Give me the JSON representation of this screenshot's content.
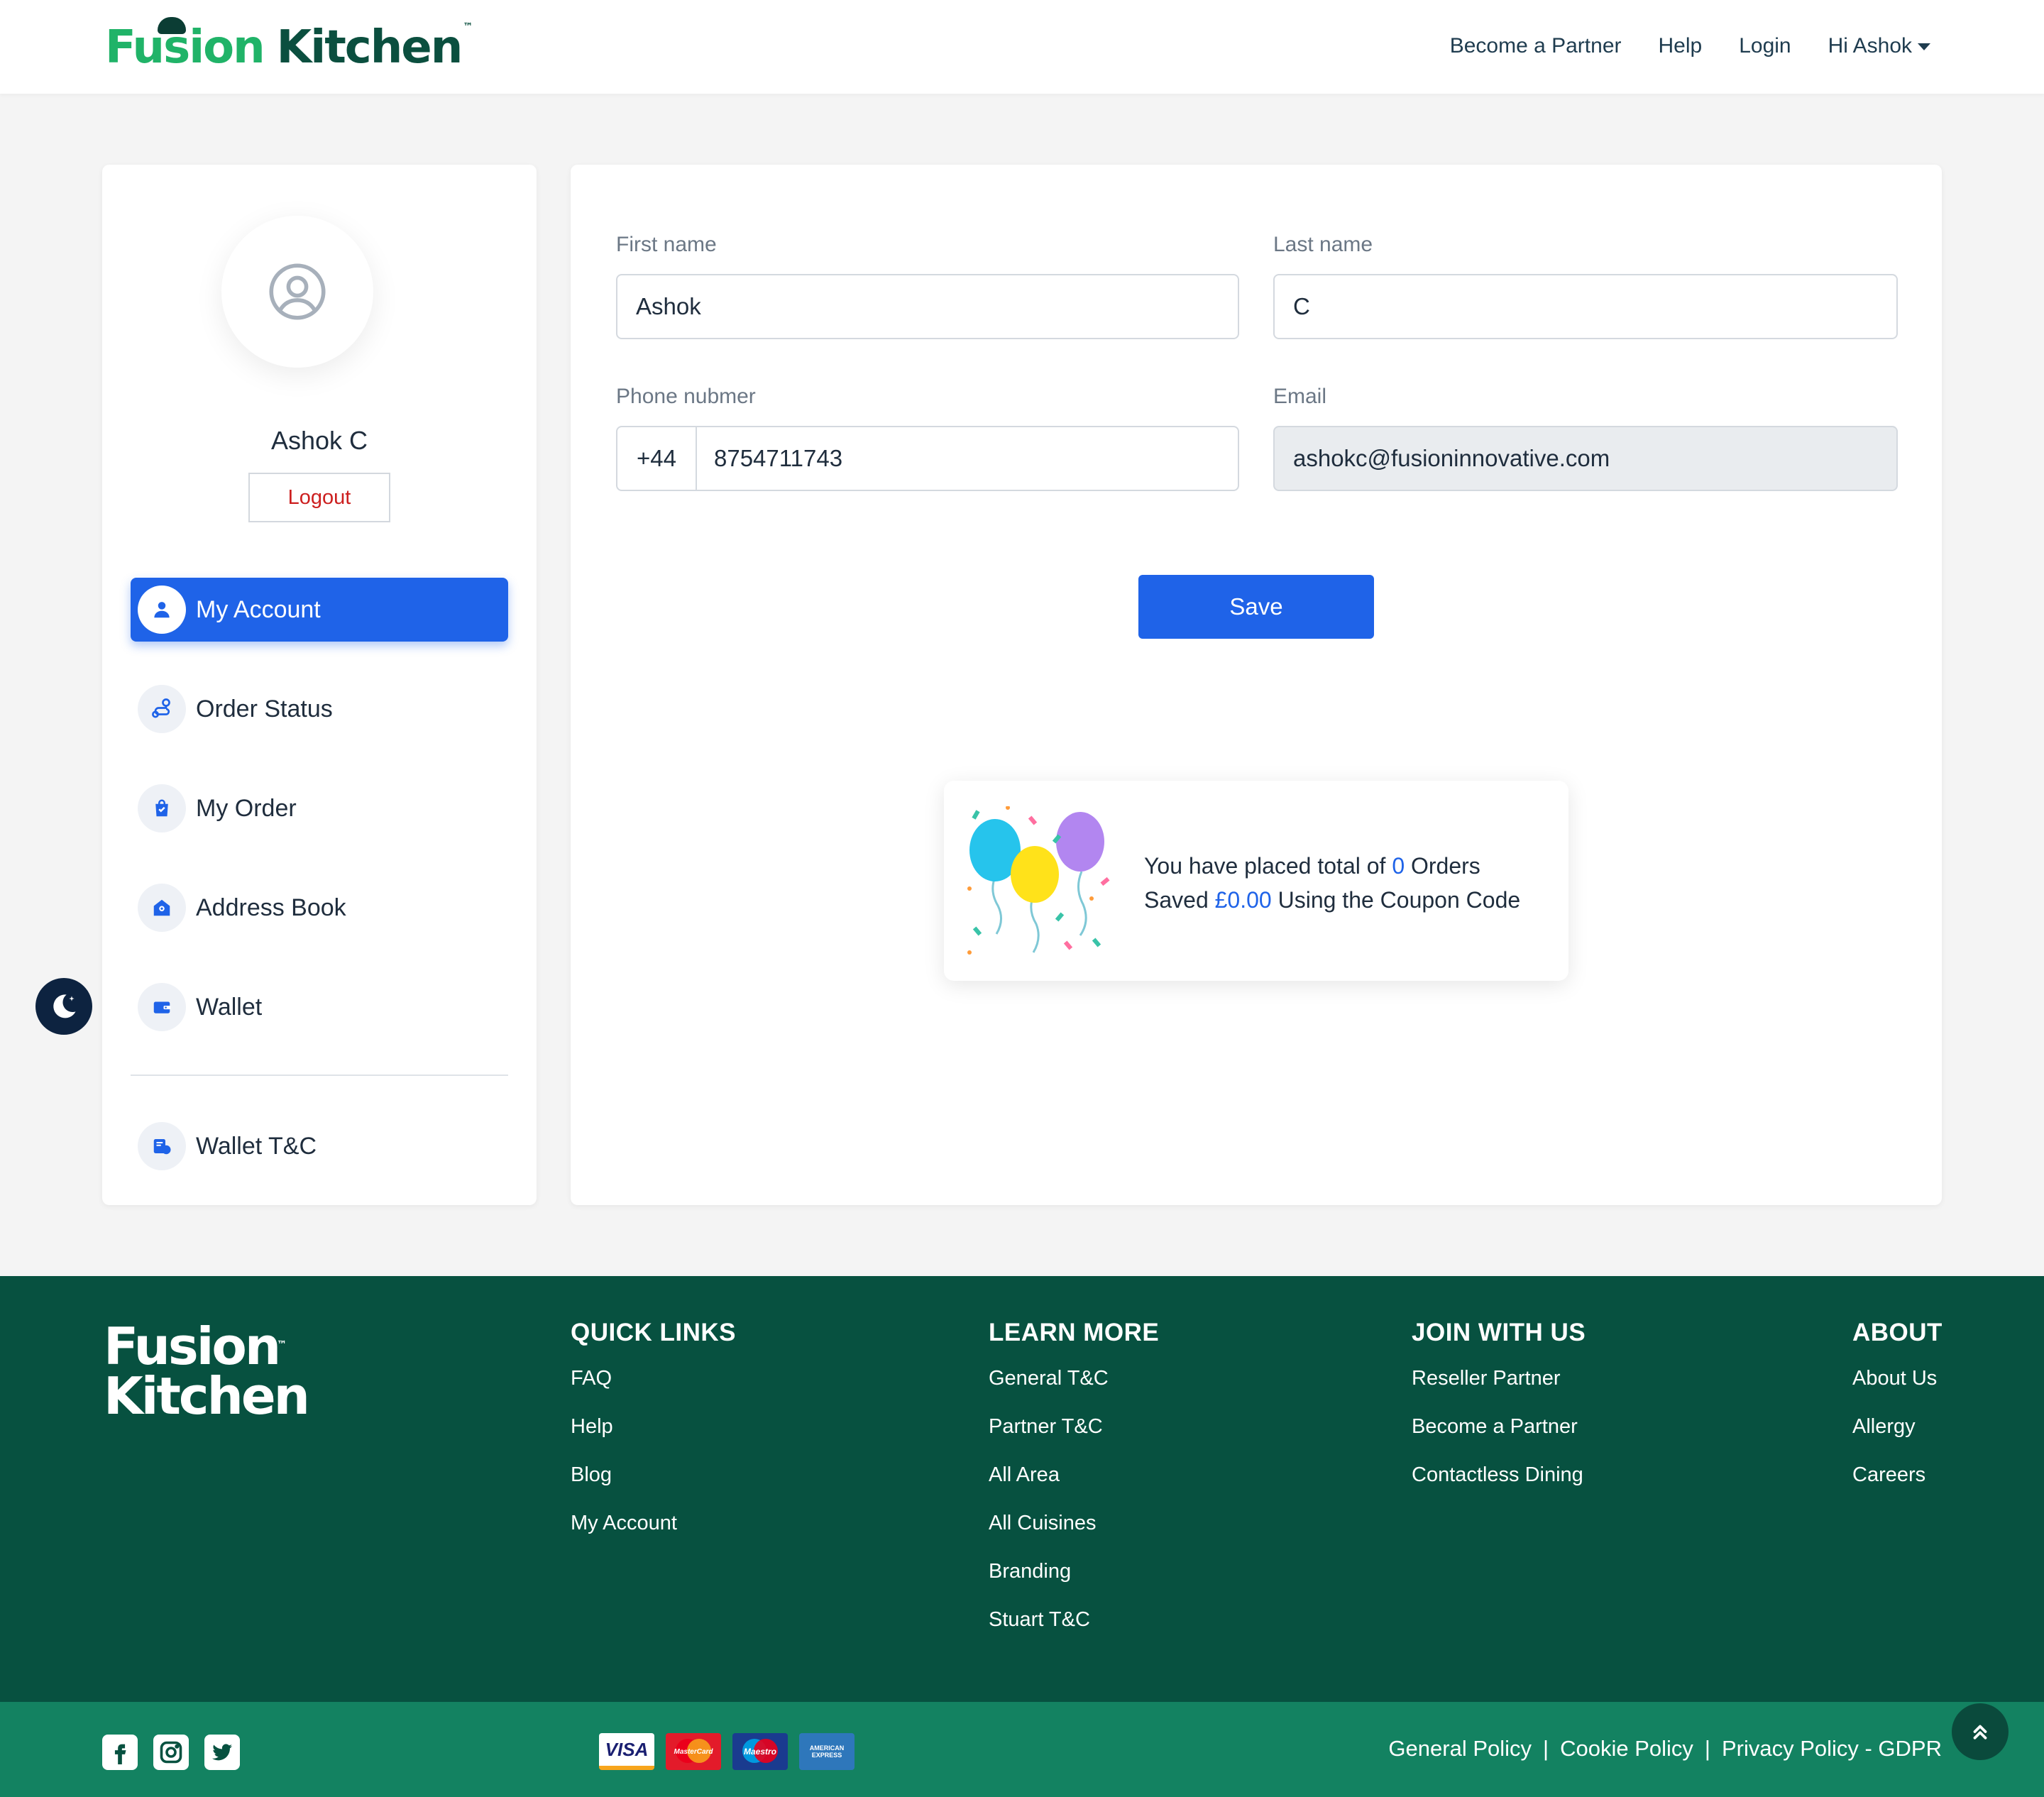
{
  "header": {
    "logo_part1": "Fusion",
    "logo_part2": "Kitchen",
    "logo_tm": "™",
    "nav": {
      "become_partner": "Become a Partner",
      "help": "Help",
      "login": "Login",
      "greeting": "Hi Ashok"
    }
  },
  "sidebar": {
    "user_name": "Ashok C",
    "logout_label": "Logout",
    "items": [
      {
        "label": "My Account",
        "icon": "user-icon",
        "active": true
      },
      {
        "label": "Order Status",
        "icon": "route-pin-icon",
        "active": false
      },
      {
        "label": "My Order",
        "icon": "shopping-bag-icon",
        "active": false
      },
      {
        "label": "Address Book",
        "icon": "home-pin-icon",
        "active": false
      },
      {
        "label": "Wallet",
        "icon": "wallet-icon",
        "active": false
      }
    ],
    "extra_item": {
      "label": "Wallet T&C",
      "icon": "wallet-terms-icon"
    }
  },
  "form": {
    "first_name": {
      "label": "First name",
      "value": "Ashok"
    },
    "last_name": {
      "label": "Last name",
      "value": "C"
    },
    "phone": {
      "label": "Phone nubmer",
      "prefix": "+44",
      "value": "8754711743"
    },
    "email": {
      "label": "Email",
      "value": "ashokc@fusioninnovative.com"
    },
    "save_label": "Save"
  },
  "stats": {
    "line1_prefix": "You have placed total of",
    "orders_count": "0",
    "line1_suffix": "Orders",
    "line2_prefix": "Saved",
    "saved_amount": "£0.00",
    "line2_suffix": "Using the Coupon Code"
  },
  "footer": {
    "logo_line1": "Fusion",
    "logo_line2": "Kitchen",
    "logo_tm": "™",
    "quick_links": {
      "title": "QUICK LINKS",
      "items": [
        "FAQ",
        "Help",
        "Blog",
        "My Account"
      ]
    },
    "learn_more": {
      "title": "LEARN MORE",
      "items": [
        "General T&C",
        "Partner T&C",
        "All Area",
        "All Cuisines",
        "Branding",
        "Stuart T&C"
      ]
    },
    "join_with_us": {
      "title": "JOIN WITH US",
      "items": [
        "Reseller Partner",
        "Become a Partner",
        "Contactless Dining"
      ]
    },
    "about": {
      "title": "ABOUT",
      "items": [
        "About Us",
        "Allergy",
        "Careers"
      ]
    }
  },
  "bottom_bar": {
    "social_icons": [
      "facebook-icon",
      "instagram-icon",
      "twitter-icon"
    ],
    "payment_cards": {
      "visa": "VISA",
      "mastercard": "MasterCard",
      "maestro": "Maestro",
      "amex": "AMERICAN EXPRESS"
    },
    "policies": {
      "general": "General Policy",
      "separator": "|",
      "cookie": "Cookie Policy",
      "privacy": "Privacy Policy - GDPR"
    }
  },
  "colors": {
    "brand_green": "#20b368",
    "brand_dark": "#0b4f3f",
    "primary_blue": "#1f63e8",
    "logout_red": "#cc1f1f",
    "footer_bg": "#075140",
    "bottom_bar_bg": "#138261"
  }
}
